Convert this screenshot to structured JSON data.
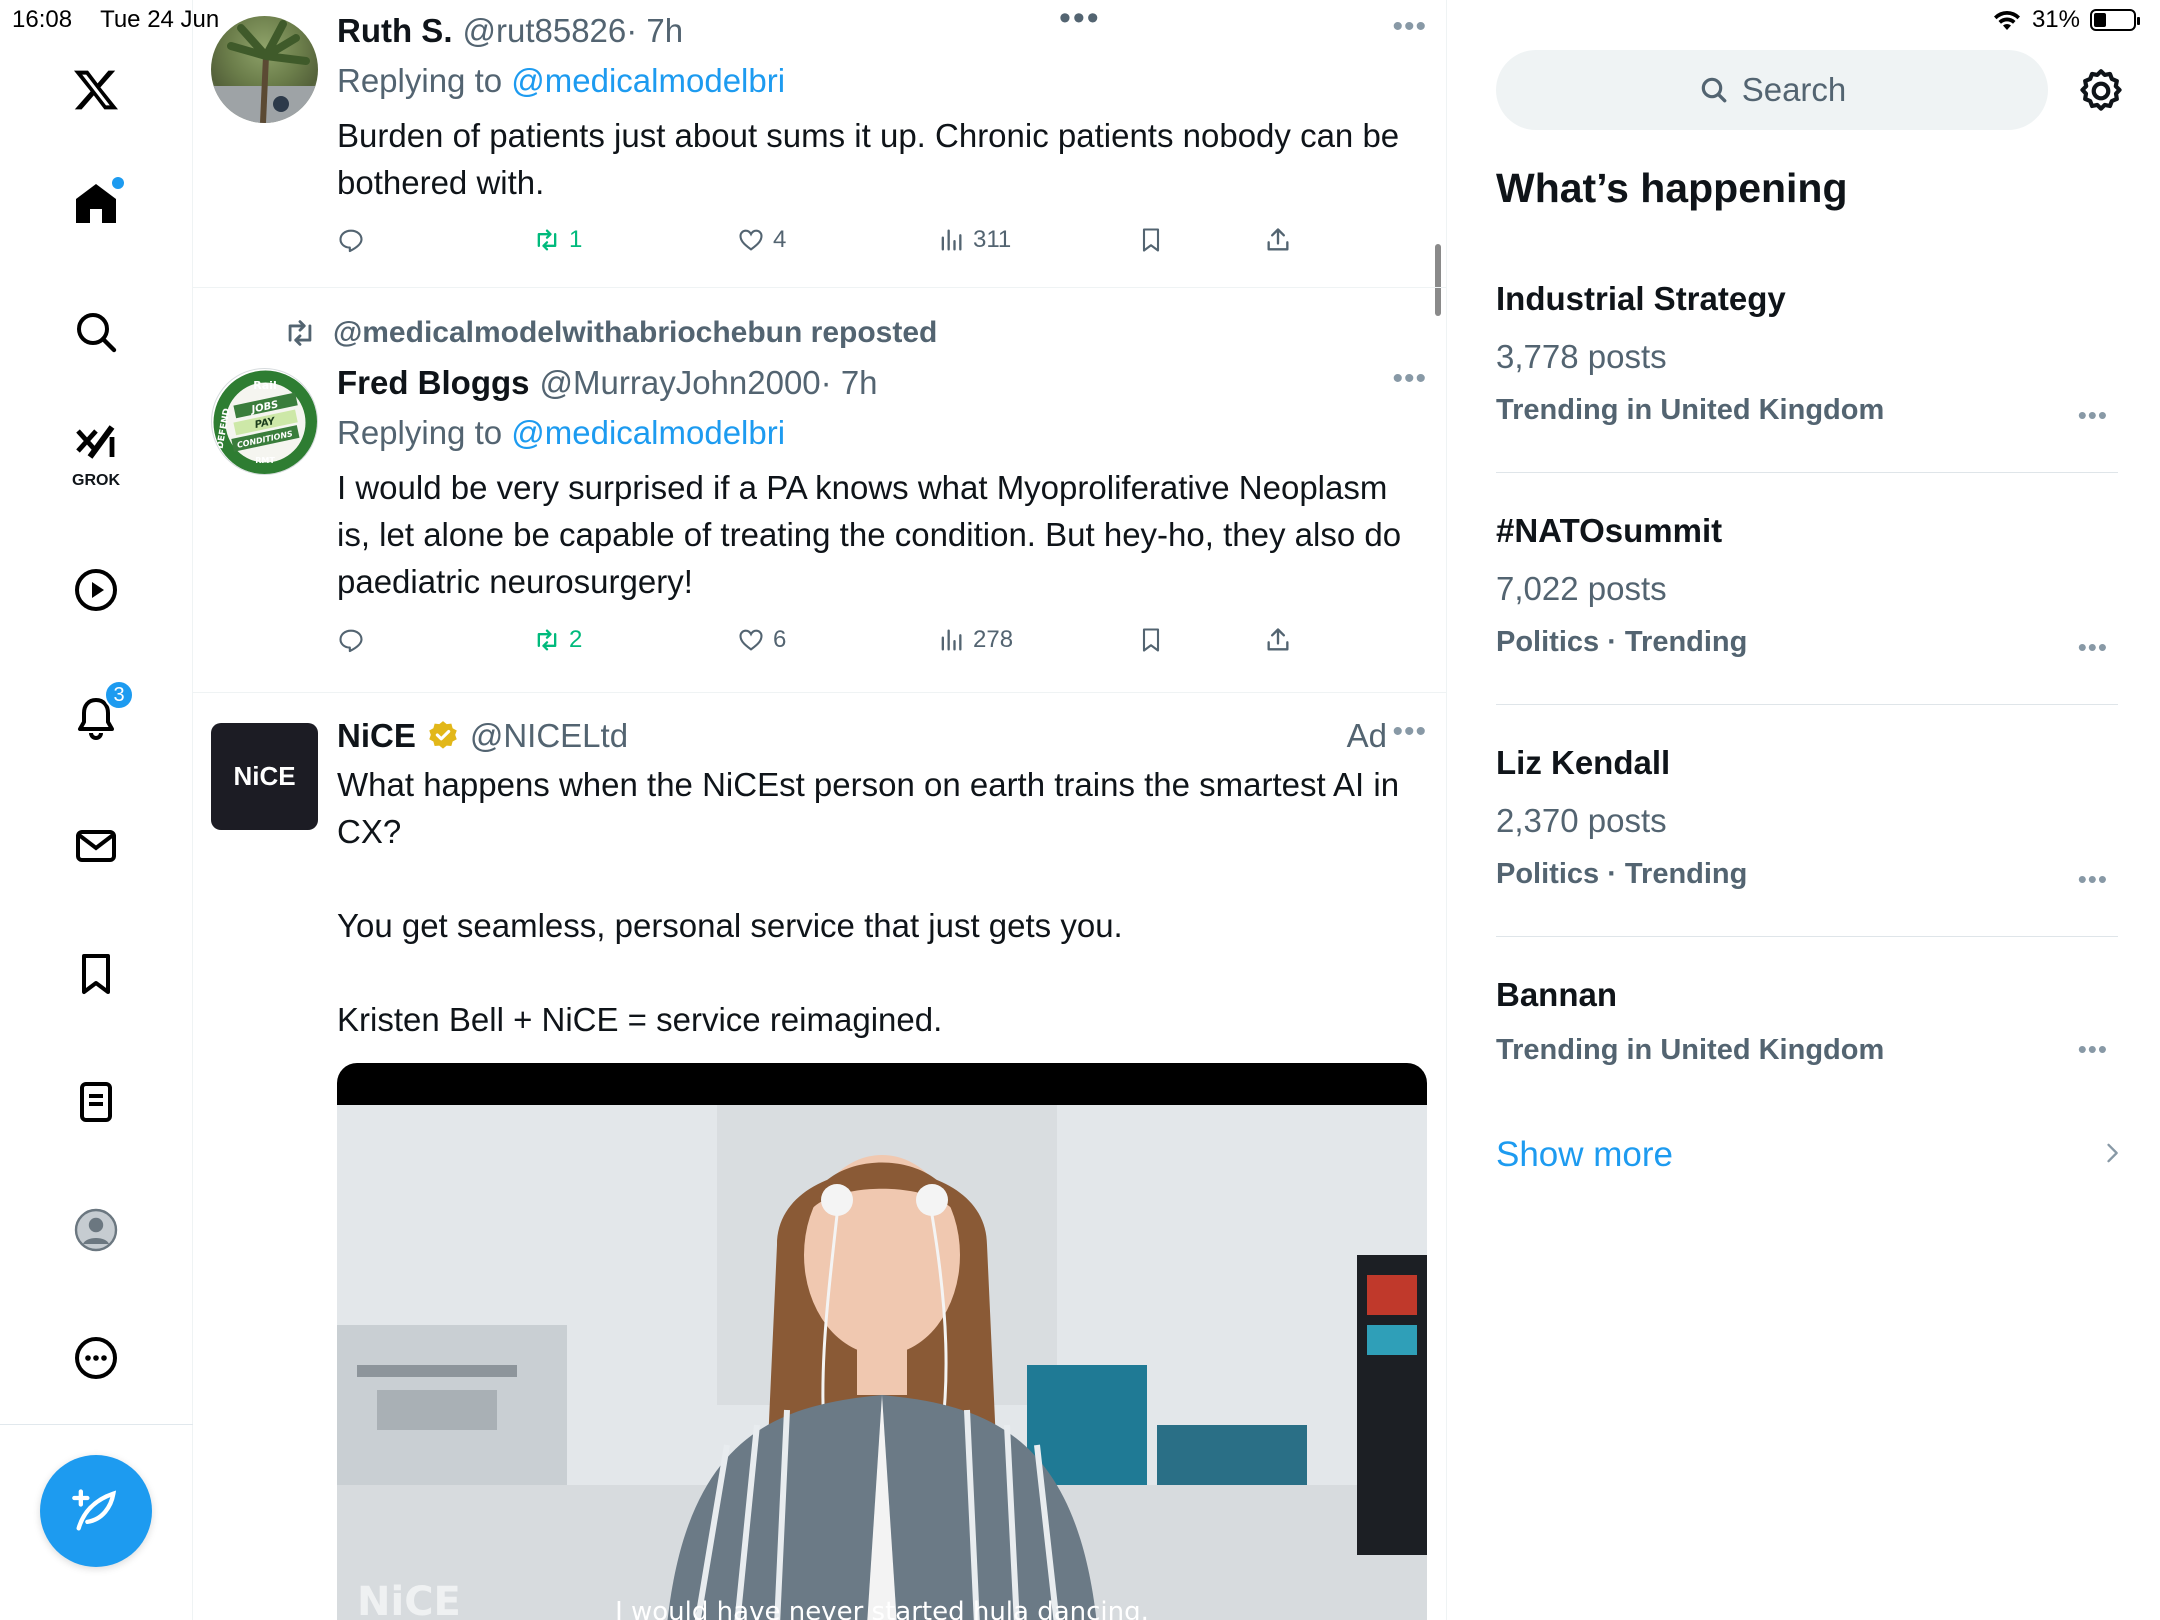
{
  "status_bar": {
    "time": "16:08",
    "date": "Tue 24 Jun",
    "battery": "31%",
    "battery_level": 0.31
  },
  "nav": {
    "grok_label": "GROK",
    "notifications_badge": "3",
    "items": [
      {
        "name": "home-icon"
      },
      {
        "name": "search-icon"
      },
      {
        "name": "grok-icon"
      },
      {
        "name": "video-icon"
      },
      {
        "name": "notifications-icon"
      },
      {
        "name": "messages-icon"
      },
      {
        "name": "bookmarks-icon"
      },
      {
        "name": "lists-icon"
      },
      {
        "name": "profile-icon"
      },
      {
        "name": "more-icon"
      }
    ],
    "compose_icon": "compose-icon"
  },
  "feed": {
    "tweets": [
      {
        "name": "Ruth S.",
        "handle": "@rut85826",
        "time": "· 7h",
        "replying_prefix": "Replying to",
        "replying_to": "@medicalmodelbri",
        "text": "Burden of patients just about sums it up. Chronic patients nobody can be bothered with.",
        "retweets": "1",
        "likes": "4",
        "views": "311"
      },
      {
        "repost_by": "@medicalmodelwithabriochebun reposted",
        "name": "Fred Bloggs",
        "handle": "@MurrayJohn2000",
        "time": "· 7h",
        "replying_prefix": "Replying to",
        "replying_to": "@medicalmodelbri",
        "text": "I would be very surprised if a PA knows what Myoproliferative Neoplasm is, let alone be capable of treating the condition. But hey-ho, they also do paediatric neurosurgery!",
        "retweets": "2",
        "likes": "6",
        "views": "278",
        "avatar_text": [
          "DEFEND",
          "Rail",
          "JOBS",
          "PAY",
          "CONDITIONS",
          "RMT"
        ]
      },
      {
        "name": "NiCE",
        "handle": "@NICELtd",
        "ad_label": "Ad",
        "avatar_text": "NiCE",
        "text": "What happens when the NiCEst person on earth trains the smartest AI in CX?\n\nYou get seamless, personal service that just gets you.\n\nKristen Bell + NiCE = service reimagined.",
        "video_caption": "I would have never started hula dancing.",
        "video_watermark": "NiCE"
      }
    ]
  },
  "sidebar": {
    "search_placeholder": "Search",
    "title": "What’s happening",
    "trends": [
      {
        "name": "Industrial Strategy",
        "count": "3,778 posts",
        "context": "Trending in United Kingdom"
      },
      {
        "name": "#NATOsummit",
        "count": "7,022 posts",
        "context": "Politics · Trending"
      },
      {
        "name": "Liz Kendall",
        "count": "2,370 posts",
        "context": "Politics · Trending"
      },
      {
        "name": "Bannan",
        "count": "",
        "context": "Trending in United Kingdom"
      }
    ],
    "show_more": "Show more"
  },
  "colors": {
    "accent": "#1d9bf0",
    "text": "#0f1419",
    "secondary": "#536471",
    "retweet_green": "#00ba7c",
    "border": "#eff3f4"
  }
}
